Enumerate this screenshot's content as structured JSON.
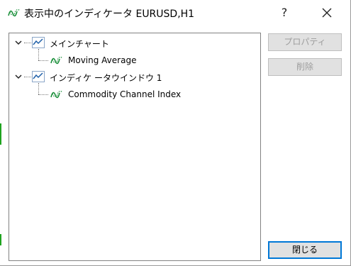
{
  "window": {
    "title": "表示中のインディケータ EURUSD,H1",
    "help_label": "?",
    "close_icon": "close-icon",
    "title_icon": "indicator-icon"
  },
  "tree": {
    "groups": [
      {
        "label": "メインチャート",
        "icon": "chart-window-icon",
        "expanded": true,
        "children": [
          {
            "label": "Moving Average",
            "icon": "indicator-icon"
          }
        ]
      },
      {
        "label": "インディケ ータウインドウ 1",
        "icon": "chart-window-icon",
        "expanded": true,
        "children": [
          {
            "label": "Commodity Channel Index",
            "icon": "indicator-icon"
          }
        ]
      }
    ]
  },
  "buttons": {
    "properties": {
      "label": "プロパティ",
      "enabled": false
    },
    "delete": {
      "label": "削除",
      "enabled": false
    },
    "close": {
      "label": "閉じる",
      "enabled": true
    }
  },
  "colors": {
    "indicator_green": "#1a8f3a",
    "chart_blue": "#1e5fa8",
    "focus_border": "#0078d7",
    "disabled_text": "#9d9d9d"
  }
}
